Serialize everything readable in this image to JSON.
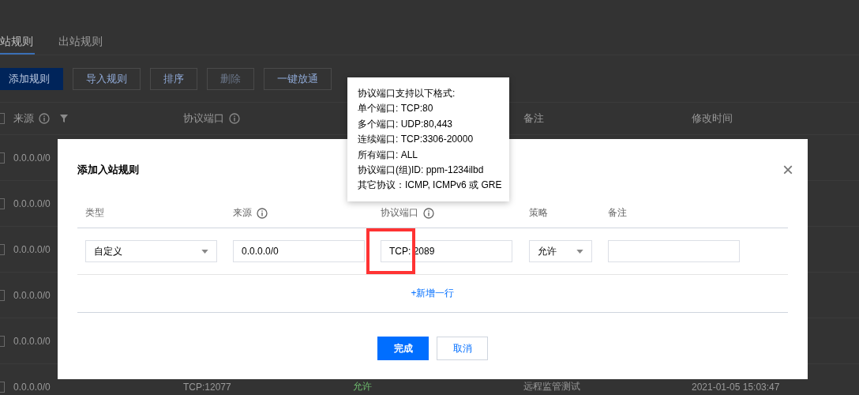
{
  "page": {
    "tabs": [
      {
        "label": "站规则",
        "selected": true
      },
      {
        "label": "出站规则",
        "selected": false
      }
    ],
    "toolbar": [
      {
        "label": "添加规则",
        "kind": "primary",
        "disabled": false
      },
      {
        "label": "导入规则",
        "kind": "default",
        "disabled": false
      },
      {
        "label": "排序",
        "kind": "default",
        "disabled": false
      },
      {
        "label": "删除",
        "kind": "default",
        "disabled": true
      },
      {
        "label": "一键放通",
        "kind": "default",
        "disabled": false
      }
    ],
    "table": {
      "all_checked": false,
      "columns": [
        {
          "label": "来源",
          "kind": "info"
        },
        {
          "kind": "filter"
        },
        {
          "label": "协议端口",
          "kind": "info"
        },
        {
          "label": "备注",
          "kind": "plain"
        },
        {
          "label": "修改时间",
          "kind": "plain"
        }
      ],
      "rows": [
        {
          "checked": false,
          "source": "0.0.0.0/0"
        },
        {
          "checked": false,
          "source": "0.0.0.0/0"
        },
        {
          "checked": false,
          "source": "0.0.0.0/0"
        },
        {
          "checked": false,
          "source": "0.0.0.0/0"
        },
        {
          "checked": false,
          "source": "0.0.0.0/0"
        },
        {
          "checked": false,
          "source": "0.0.0.0/0",
          "port": "TCP:12077",
          "policy": "允许",
          "note": "远程监管测试",
          "modified": "2021-01-05 15:03:47"
        }
      ]
    }
  },
  "dialog": {
    "title": "添加入站规则",
    "close": "×",
    "columns": [
      {
        "label": "类型",
        "kind": "plain"
      },
      {
        "label": "来源",
        "kind": "info"
      },
      {
        "label": "协议端口",
        "kind": "info"
      },
      {
        "label": "策略",
        "kind": "plain"
      },
      {
        "label": "备注",
        "kind": "plain"
      }
    ],
    "rows": [
      {
        "type": "自定义",
        "source": "0.0.0.0/0",
        "port": "TCP: 2089",
        "policy": "允许"
      }
    ],
    "add_row": "+新增一行",
    "buttons": [
      {
        "label": "完成",
        "kind": "primary"
      },
      {
        "label": "取消",
        "kind": "default"
      }
    ]
  },
  "tooltip": {
    "lines": [
      "协议端口支持以下格式:",
      "单个端口: TCP:80",
      "多个端口: UDP:80,443",
      "连续端口: TCP:3306-20000",
      "所有端口: ALL",
      "协议端口(组)ID: ppm-1234ilbd",
      "其它协议：ICMP, ICMPv6 或 GRE"
    ]
  },
  "highlight": {
    "on": true
  }
}
